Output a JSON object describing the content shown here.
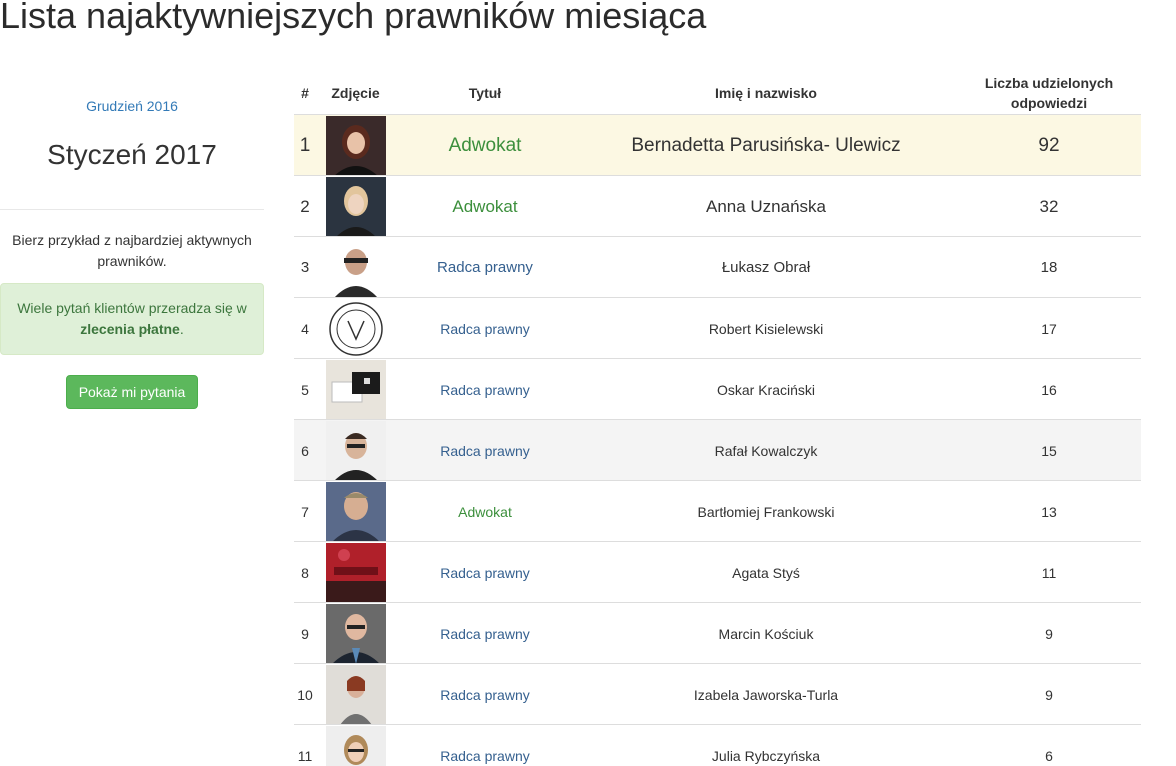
{
  "page": {
    "title": "Lista najaktywniejszych prawników miesiąca"
  },
  "sidebar": {
    "prev_month": "Grudzień 2016",
    "current_month": "Styczeń 2017",
    "intro_text": "Bierz przykład z najbardziej aktywnych prawników.",
    "alert_text_before": "Wiele pytań klientów przeradza się w ",
    "alert_text_bold": "zlecenia płatne",
    "alert_text_after": ".",
    "button_label": "Pokaż mi pytania"
  },
  "table": {
    "headers": {
      "num": "#",
      "photo": "Zdjęcie",
      "title": "Tytuł",
      "name": "Imię i nazwisko",
      "count": "Liczba udzielonych odpowiedzi"
    },
    "rows": [
      {
        "num": "1",
        "title": "Adwokat",
        "name": "Bernadetta Parusińska- Ulewicz",
        "count": "92"
      },
      {
        "num": "2",
        "title": "Adwokat",
        "name": "Anna Uznańska",
        "count": "32"
      },
      {
        "num": "3",
        "title": "Radca prawny",
        "name": "Łukasz Obrał",
        "count": "18"
      },
      {
        "num": "4",
        "title": "Radca prawny",
        "name": "Robert Kisielewski",
        "count": "17"
      },
      {
        "num": "5",
        "title": "Radca prawny",
        "name": "Oskar Kraciński",
        "count": "16"
      },
      {
        "num": "6",
        "title": "Radca prawny",
        "name": "Rafał Kowalczyk",
        "count": "15"
      },
      {
        "num": "7",
        "title": "Adwokat",
        "name": "Bartłomiej Frankowski",
        "count": "13"
      },
      {
        "num": "8",
        "title": "Radca prawny",
        "name": "Agata Styś",
        "count": "11"
      },
      {
        "num": "9",
        "title": "Radca prawny",
        "name": "Marcin Kościuk",
        "count": "9"
      },
      {
        "num": "10",
        "title": "Radca prawny",
        "name": "Izabela Jaworska-Turla",
        "count": "9"
      },
      {
        "num": "11",
        "title": "Radca prawny",
        "name": "Julia Rybczyńska",
        "count": "6"
      }
    ]
  },
  "colors": {
    "accent_link": "#337ab7",
    "adwokat": "#3c8f3c",
    "radca": "#35608f",
    "highlight_row": "#fcf8e3",
    "alert_bg": "#dff0d8",
    "button_bg": "#5cb85c"
  }
}
